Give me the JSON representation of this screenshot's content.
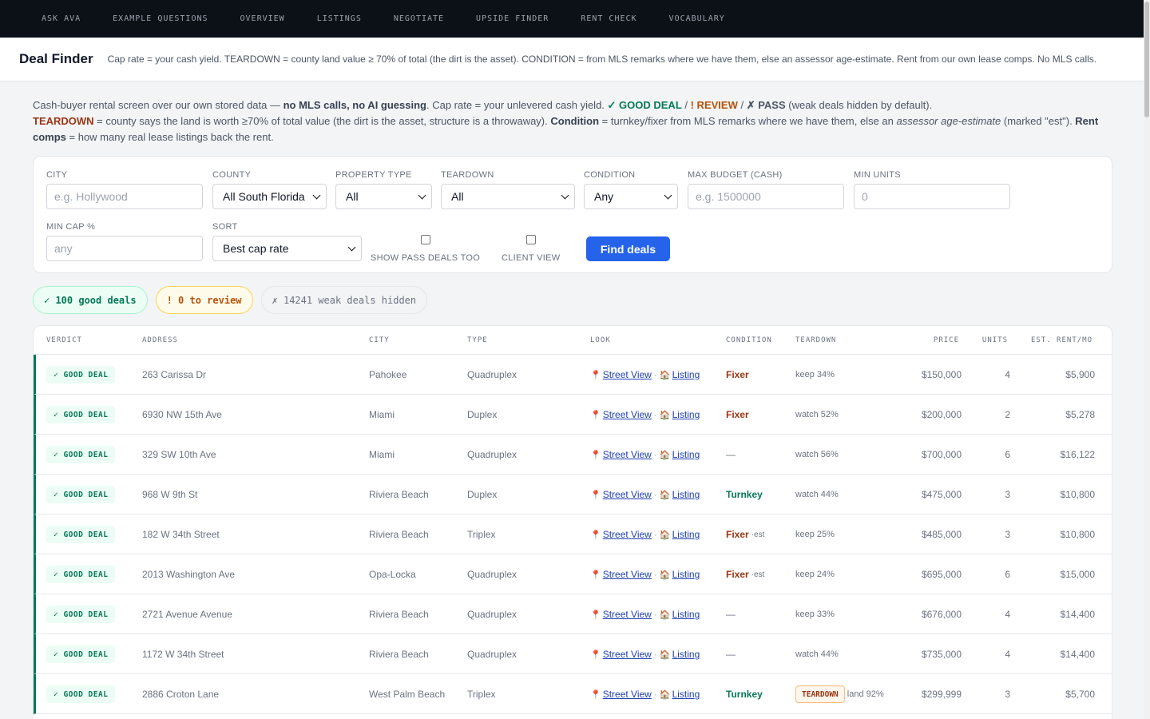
{
  "nav": [
    "ASK AVA",
    "EXAMPLE QUESTIONS",
    "OVERVIEW",
    "LISTINGS",
    "NEGOTIATE",
    "UPSIDE FINDER",
    "RENT CHECK",
    "VOCABULARY"
  ],
  "header": {
    "title": "Deal Finder",
    "description": "Cap rate = your cash yield. TEARDOWN = county land value ≥ 70% of total (the dirt is the asset). CONDITION = from MLS remarks where we have them, else an assessor age-estimate. Rent from our own lease comps. No MLS calls."
  },
  "intro": {
    "p1": "Cash-buyer rental screen over our own stored data — ",
    "p1b": "no MLS calls, no AI guessing",
    "p2": ". Cap rate = your unlevered cash yield. ",
    "good": "✓ GOOD DEAL",
    "sep1": " / ",
    "review": "! REVIEW",
    "sep2": " / ",
    "pass": "✗ PASS",
    "p3": " (weak deals hidden by default).",
    "teardown": "TEARDOWN",
    "p4": " = county says the land is worth ≥70% of total value (the dirt is the asset, structure is a throwaway). ",
    "condition": "Condition",
    "p5": " = turnkey/fixer from MLS remarks where we have them, else an ",
    "assessor": "assessor age-estimate",
    "p6": " (marked \"est\"). ",
    "rentcomps": "Rent comps",
    "p7": " = how many real lease listings back the rent."
  },
  "filters": {
    "city_label": "CITY",
    "city_placeholder": "e.g. Hollywood",
    "county_label": "COUNTY",
    "county_value": "All South Florida",
    "type_label": "PROPERTY TYPE",
    "type_value": "All",
    "teardown_label": "TEARDOWN",
    "teardown_value": "All",
    "condition_label": "CONDITION",
    "condition_value": "Any",
    "budget_label": "MAX BUDGET (CASH)",
    "budget_placeholder": "e.g. 1500000",
    "units_label": "MIN UNITS",
    "units_placeholder": "0",
    "cap_label": "MIN CAP %",
    "cap_placeholder": "any",
    "sort_label": "SORT",
    "sort_value": "Best cap rate",
    "show_pass_label": "SHOW PASS DEALS TOO",
    "client_view_label": "CLIENT VIEW",
    "find_button": "Find deals"
  },
  "summary": {
    "good": "✓ 100 good deals",
    "review": "! 0 to review",
    "hidden": "✗ 14241 weak deals hidden"
  },
  "table": {
    "headers": [
      "VERDICT",
      "ADDRESS",
      "CITY",
      "TYPE",
      "LOOK",
      "CONDITION",
      "TEARDOWN",
      "PRICE",
      "UNITS",
      "EST. RENT/MO"
    ],
    "street_view_label": "Street View",
    "listing_label": "Listing",
    "rows": [
      {
        "verdict": "✓ GOOD DEAL",
        "address": "263 Carissa Dr",
        "city": "Pahokee",
        "type": "Quadruplex",
        "condition": "Fixer",
        "cond_est": "",
        "teardown_badge": "",
        "teardown": "keep 34%",
        "price": "$150,000",
        "units": "4",
        "rent": "$5,900"
      },
      {
        "verdict": "✓ GOOD DEAL",
        "address": "6930 NW 15th Ave",
        "city": "Miami",
        "type": "Duplex",
        "condition": "Fixer",
        "cond_est": "",
        "teardown_badge": "",
        "teardown": "watch 52%",
        "price": "$200,000",
        "units": "2",
        "rent": "$5,278"
      },
      {
        "verdict": "✓ GOOD DEAL",
        "address": "329 SW 10th Ave",
        "city": "Miami",
        "type": "Quadruplex",
        "condition": "—",
        "cond_est": "",
        "teardown_badge": "",
        "teardown": "watch 56%",
        "price": "$700,000",
        "units": "6",
        "rent": "$16,122"
      },
      {
        "verdict": "✓ GOOD DEAL",
        "address": "968 W 9th St",
        "city": "Riviera Beach",
        "type": "Duplex",
        "condition": "Turnkey",
        "cond_est": "",
        "teardown_badge": "",
        "teardown": "watch 44%",
        "price": "$475,000",
        "units": "3",
        "rent": "$10,800"
      },
      {
        "verdict": "✓ GOOD DEAL",
        "address": "182 W 34th Street",
        "city": "Riviera Beach",
        "type": "Triplex",
        "condition": "Fixer",
        "cond_est": "·est",
        "teardown_badge": "",
        "teardown": "keep 25%",
        "price": "$485,000",
        "units": "3",
        "rent": "$10,800"
      },
      {
        "verdict": "✓ GOOD DEAL",
        "address": "2013 Washington Ave",
        "city": "Opa-Locka",
        "type": "Quadruplex",
        "condition": "Fixer",
        "cond_est": "·est",
        "teardown_badge": "",
        "teardown": "keep 24%",
        "price": "$695,000",
        "units": "6",
        "rent": "$15,000"
      },
      {
        "verdict": "✓ GOOD DEAL",
        "address": "2721 Avenue Avenue",
        "city": "Riviera Beach",
        "type": "Quadruplex",
        "condition": "—",
        "cond_est": "",
        "teardown_badge": "",
        "teardown": "keep 33%",
        "price": "$676,000",
        "units": "4",
        "rent": "$14,400"
      },
      {
        "verdict": "✓ GOOD DEAL",
        "address": "1172 W 34th Street",
        "city": "Riviera Beach",
        "type": "Quadruplex",
        "condition": "—",
        "cond_est": "",
        "teardown_badge": "",
        "teardown": "watch 44%",
        "price": "$735,000",
        "units": "4",
        "rent": "$14,400"
      },
      {
        "verdict": "✓ GOOD DEAL",
        "address": "2886 Croton Lane",
        "city": "West Palm Beach",
        "type": "Triplex",
        "condition": "Turnkey",
        "cond_est": "",
        "teardown_badge": "TEARDOWN",
        "teardown": "land 92%",
        "price": "$299,999",
        "units": "3",
        "rent": "$5,700"
      }
    ]
  }
}
